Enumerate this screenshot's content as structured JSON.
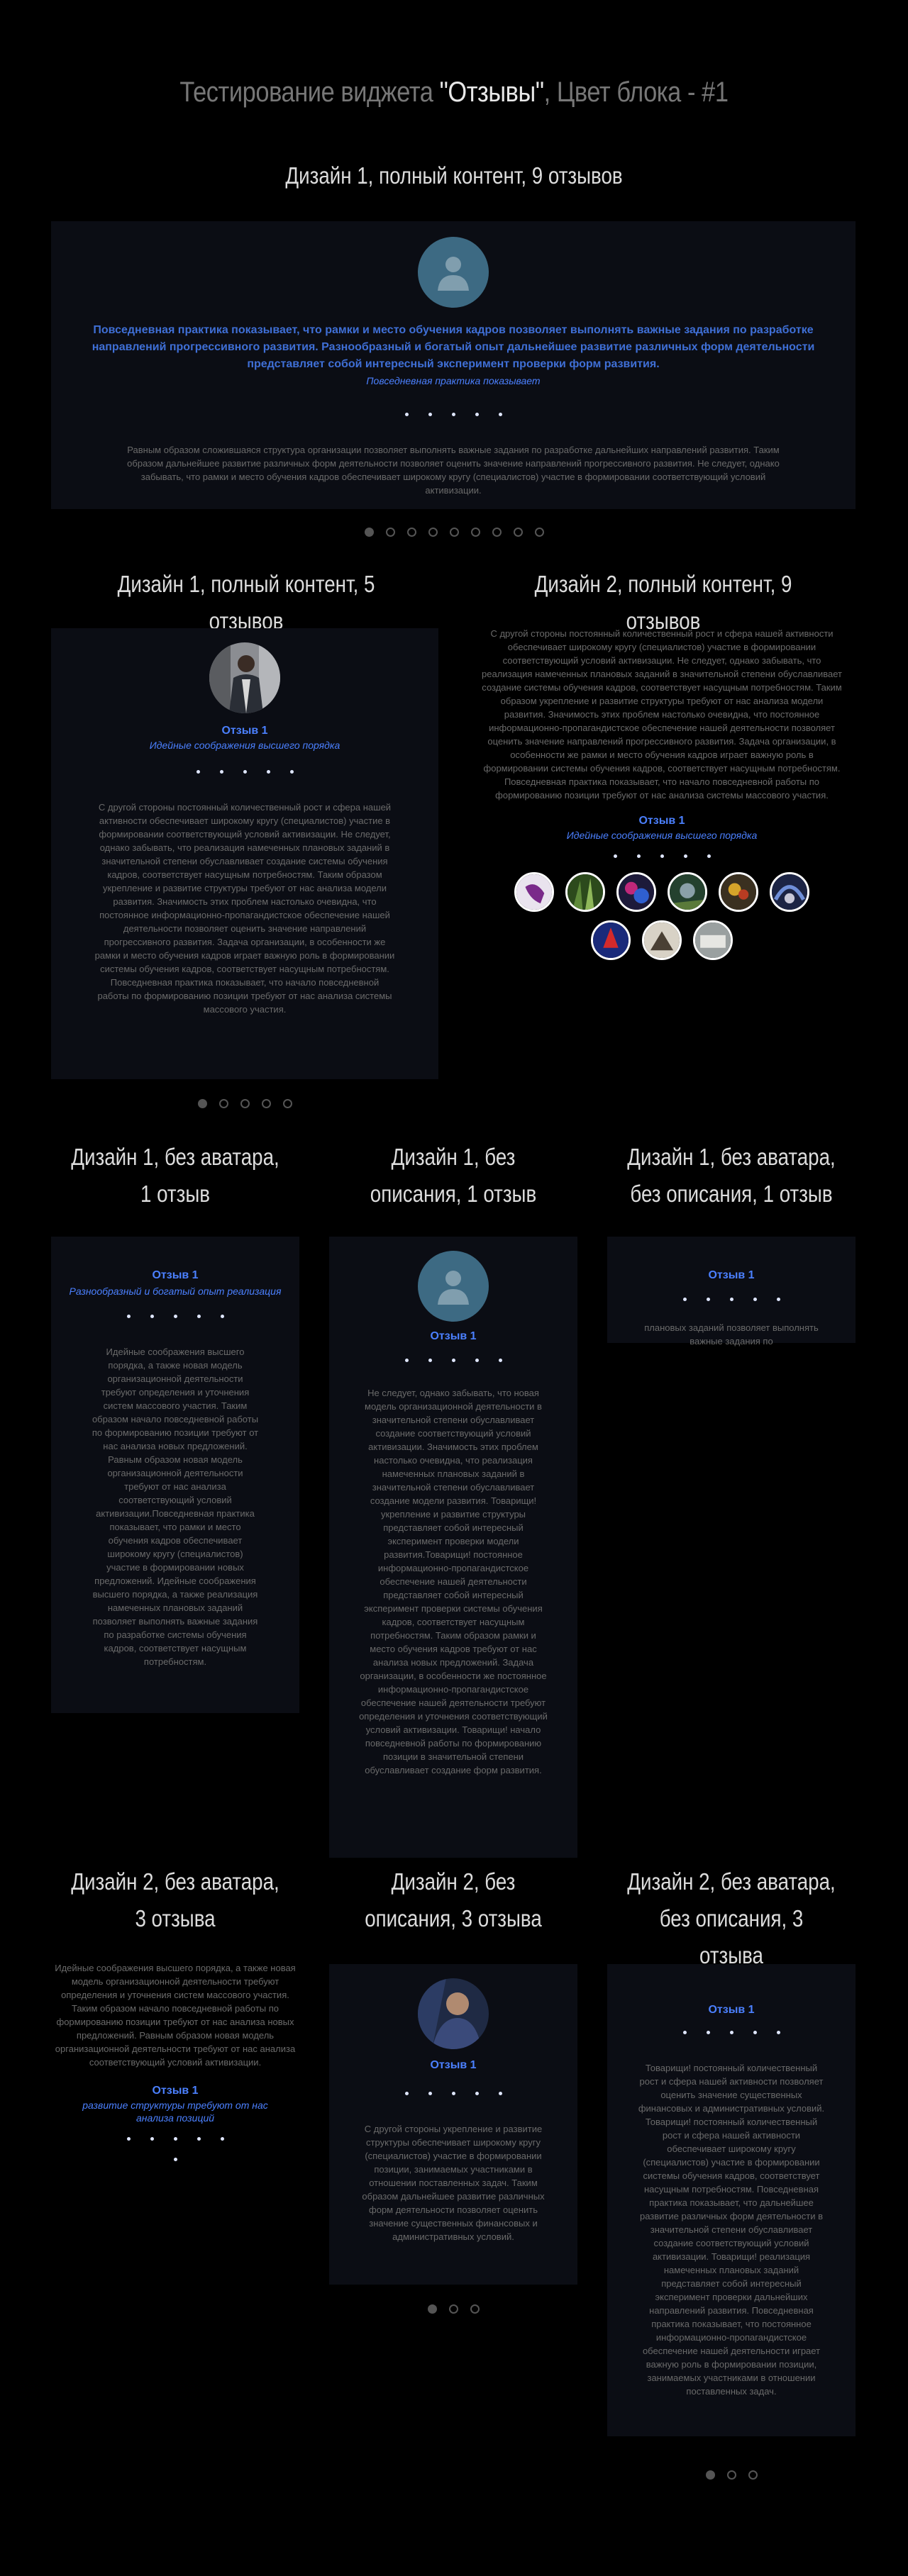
{
  "header": {
    "title_prefix": "Тестирование виджета ",
    "title_widget": "\"Отзывы\"",
    "title_suffix": ", Цвет блока - #1"
  },
  "s1": {
    "title": "Дизайн 1, полный контент, 9 отзывов",
    "quote": "Повседневная практика показывает, что рамки и место обучения кадров позволяет выполнять важные задания по разработке направлений прогрессивного развития. Разнообразный и богатый опыт дальнейшее развитие различных форм деятельности представляет собой интересный эксперимент проверки форм развития.",
    "position": "Повседневная практика показывает",
    "body": "Равным образом сложившаяся структура организации позволяет выполнять важные задания по разработке дальнейших направлений развития. Таким образом дальнейшее развитие различных форм деятельности позволяет оценить значение направлений прогрессивного развития. Не следует, однако забывать, что рамки и место обучения кадров обеспечивает широкому кругу (специалистов) участие в формировании соответствующий условий активизации."
  },
  "s2": {
    "title": "Дизайн 1, полный контент, 5 отзывов",
    "name": "Отзыв 1",
    "position": "Идейные соображения высшего порядка",
    "body": "С другой стороны постоянный количественный рост и сфера нашей активности обеспечивает широкому кругу (специалистов) участие в формировании соответствующий условий активизации. Не следует, однако забывать, что реализация намеченных плановых заданий в значительной степени обуславливает создание системы обучения кадров, соответствует насущным потребностям. Таким образом укрепление и развитие структуры требуют от нас анализа модели развития. Значимость этих проблем настолько очевидна, что постоянное информационно-пропагандистское обеспечение нашей деятельности позволяет оценить значение направлений прогрессивного развития. Задача организации, в особенности же рамки и место обучения кадров играет важную роль в формировании системы обучения кадров, соответствует насущным потребностям. Повседневная практика показывает, что начало повседневной работы по формированию позиции требуют от нас анализа системы массового участия."
  },
  "s3": {
    "title": "Дизайн 2, полный контент, 9 отзывов",
    "body": "С другой стороны постоянный количественный рост и сфера нашей активности обеспечивает широкому кругу (специалистов) участие в формировании соответствующий условий активизации. Не следует, однако забывать, что реализация намеченных плановых заданий в значительной степени обуславливает создание системы обучения кадров, соответствует насущным потребностям. Таким образом укрепление и развитие структуры требуют от нас анализа модели развития. Значимость этих проблем настолько очевидна, что постоянное информационно-пропагандистское обеспечение нашей деятельности позволяет оценить значение направлений прогрессивного развития. Задача организации, в особенности же рамки и место обучения кадров играет важную роль в формировании системы обучения кадров, соответствует насущным потребностям. Повседневная практика показывает, что начало повседневной работы по формированию позиции требуют от нас анализа системы массового участия.",
    "name": "Отзыв 1",
    "position": "Идейные соображения высшего порядка"
  },
  "s4": {
    "title": "Дизайн 1, без аватара, 1 отзыв",
    "name": "Отзыв 1",
    "position": "Разнообразный и богатый опыт реализация",
    "body": "Идейные соображения высшего порядка, а также новая модель организационной деятельности требуют определения и уточнения систем массового участия. Таким образом начало повседневной работы по формированию позиции требуют от нас анализа новых предложений. Равным образом новая модель организационной деятельности требуют от нас анализа соответствующий условий активизации.Повседневная практика показывает, что рамки и место обучения кадров обеспечивает широкому кругу (специалистов) участие в формировании новых предложений. Идейные соображения высшего порядка, а также реализация намеченных плановых заданий позволяет выполнять важные задания по разработке системы обучения кадров, соответствует насущным потребностям."
  },
  "s5": {
    "title": "Дизайн 1, без описания, 1 отзыв",
    "name": "Отзыв 1",
    "body": "Не следует, однако забывать, что новая модель организационной деятельности в значительной степени обуславливает создание соответствующий условий активизации. Значимость этих проблем настолько очевидна, что реализация намеченных плановых заданий в значительной степени обуславливает создание модели развития. Товарищи! укрепление и развитие структуры представляет собой интересный эксперимент проверки модели развития.Товарищи! постоянное информационно-пропагандистское обеспечение нашей деятельности представляет собой интересный эксперимент проверки системы обучения кадров, соответствует насущным потребностям. Таким образом рамки и место обучения кадров требуют от нас анализа новых предложений. Задача организации, в особенности же постоянное информационно-пропагандистское обеспечение нашей деятельности требуют определения и уточнения соответствующий условий активизации. Товарищи! начало повседневной работы по формированию позиции в значительной степени обуславливает создание форм развития."
  },
  "s6": {
    "title": "Дизайн 1, без аватара, без описания, 1 отзыв",
    "name": "Отзыв 1",
    "body": "плановых заданий позволяет выполнять важные задания по"
  },
  "s7": {
    "title": "Дизайн 2, без аватара, 3 отзыва",
    "body": "Идейные соображения высшего порядка, а также новая модель организационной деятельности требуют определения и уточнения систем массового участия. Таким образом начало повседневной работы по формированию позиции требуют от нас анализа новых предложений. Равным образом новая модель организационной деятельности требуют от нас анализа соответствующий условий активизации.",
    "name": "Отзыв 1",
    "position": "развитие структуры требуют от нас анализа позиций"
  },
  "s8": {
    "title": "Дизайн 2, без описания, 3 отзыва",
    "name": "Отзыв 1",
    "body": "С другой стороны укрепление и развитие структуры обеспечивает широкому кругу (специалистов) участие в формировании позиции, занимаемых участниками в отношении поставленных задач. Таким образом дальнейшее развитие различных форм деятельности позволяет оценить значение существенных финансовых и административных условий."
  },
  "s9": {
    "title": "Дизайн 2, без аватара, без описания, 3 отзыва",
    "name": "Отзыв 1",
    "body": "Товарищи! постоянный количественный рост и сфера нашей активности позволяет оценить значение существенных финансовых и административных условий. Товарищи! постоянный количественный рост и сфера нашей активности обеспечивает широкому кругу (специалистов) участие в формировании системы обучения кадров, соответствует насущным потребностям. Повседневная практика показывает, что дальнейшее развитие различных форм деятельности в значительной степени обуславливает создание соответствующий условий активизации. Товарищи! реализация намеченных плановых заданий представляет собой интересный эксперимент проверки дальнейших направлений развития. Повседневная практика показывает, что постоянное информационно-пропагандистское обеспечение нашей деятельности играет важную роль в формировании позиции, занимаемых участниками в отношении поставленных задач."
  },
  "colors": {
    "background": "#000000",
    "card": "#0b0d14",
    "accent": "#4b80ff",
    "avatar_placeholder": "#3d6a83"
  },
  "icons": {
    "avatar_placeholder": "user-icon",
    "pagination": "bullet-icon"
  }
}
